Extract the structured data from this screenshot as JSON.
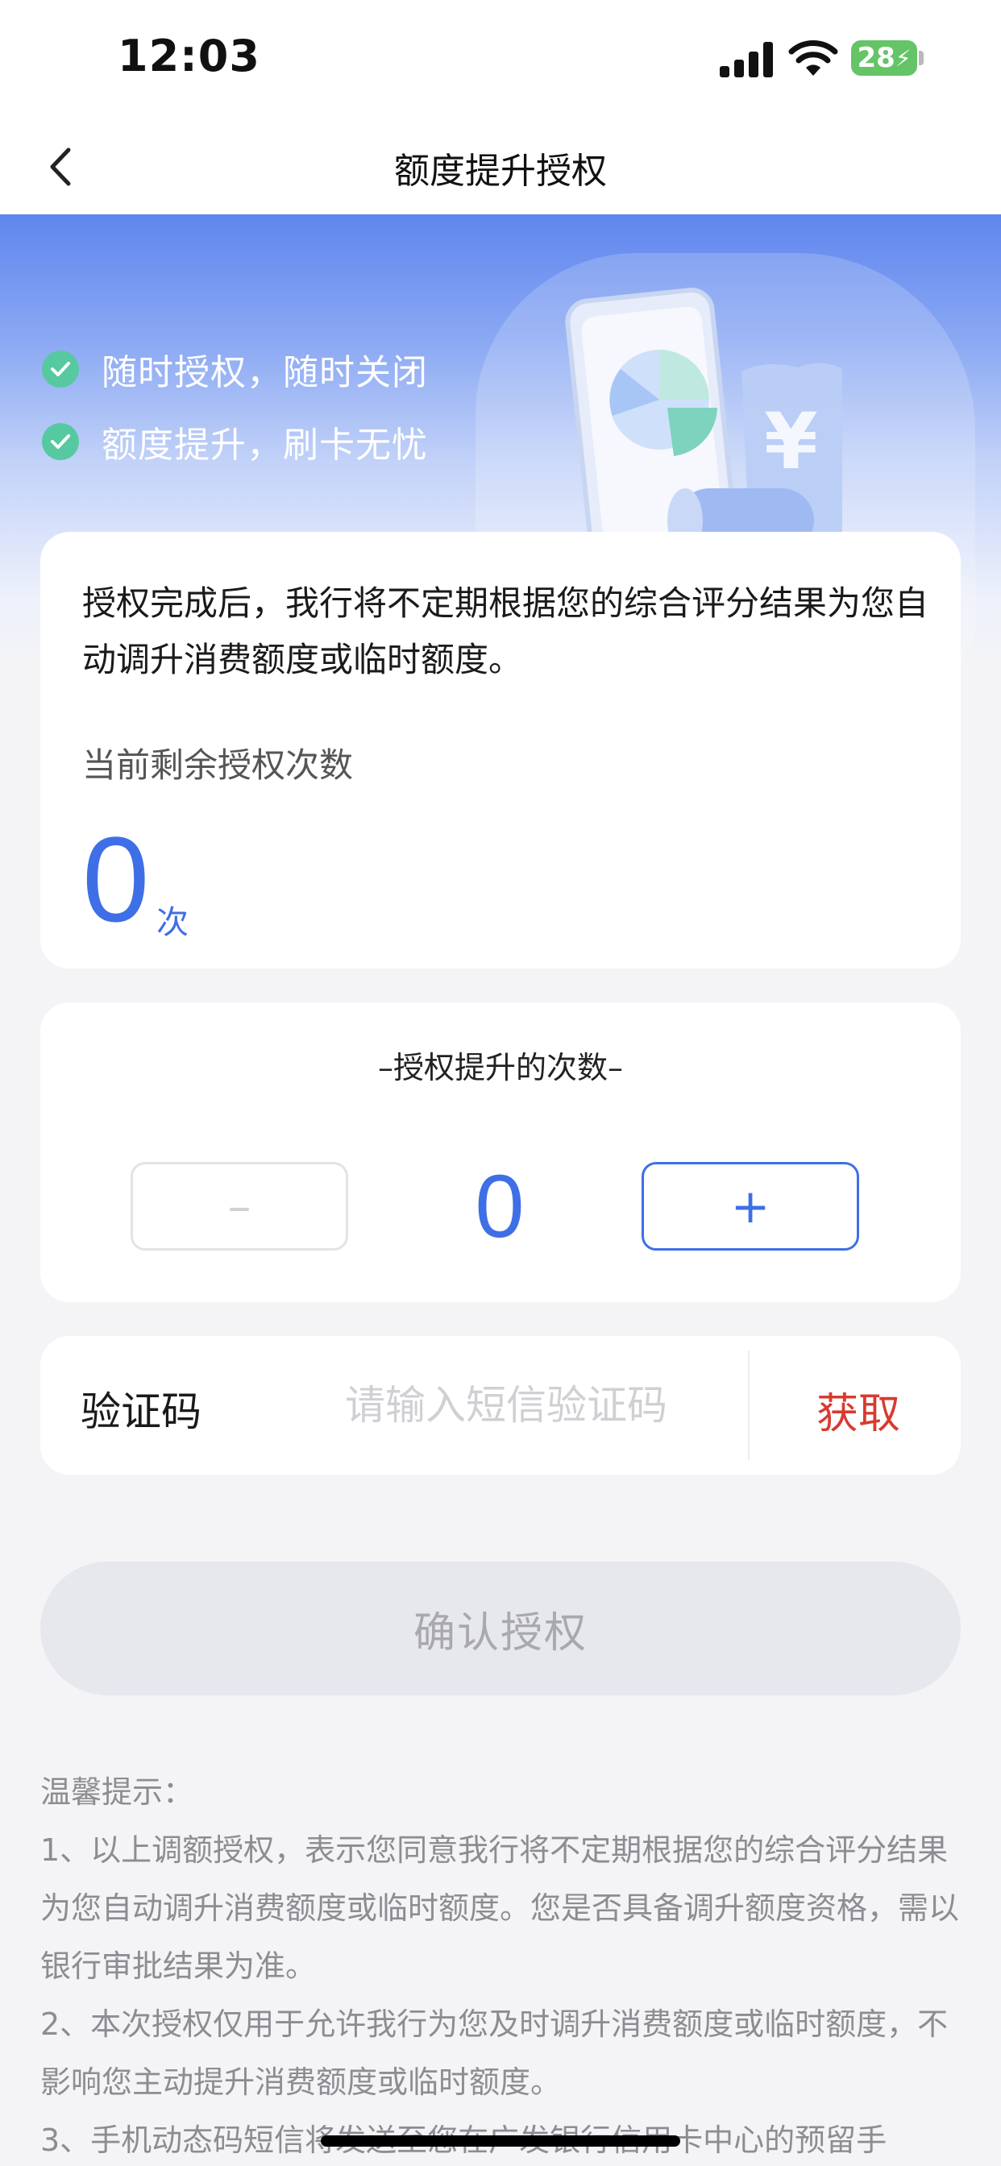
{
  "status_bar": {
    "time": "12:03",
    "battery": "28",
    "icons": [
      "signal-icon",
      "wifi-icon",
      "battery-charging-icon"
    ]
  },
  "nav": {
    "title": "额度提升授权",
    "back_icon": "chevron-left-icon"
  },
  "banner": {
    "features": [
      "随时授权，随时关闭",
      "额度提升，刷卡无忧"
    ]
  },
  "info_card": {
    "description": "授权完成后，我行将不定期根据您的综合评分结果为您自动调升消费额度或临时额度。",
    "remaining_label": "当前剩余授权次数",
    "remaining_count": "0",
    "remaining_unit": "次"
  },
  "count_card": {
    "title": "–授权提升的次数–",
    "minus_label": "–",
    "plus_label": "+",
    "value": "0"
  },
  "code_card": {
    "label": "验证码",
    "placeholder": "请输入短信验证码",
    "value": "",
    "get_label": "获取"
  },
  "confirm_label": "确认授权",
  "tips": {
    "title": "温馨提示：",
    "items": [
      "1、以上调额授权，表示您同意我行将不定期根据您的综合评分结果为您自动调升消费额度或临时额度。您是否具备调升额度资格，需以银行审批结果为准。",
      "2、本次授权仅用于允许我行为您及时调升消费额度或临时额度，不影响您主动提升消费额度或临时额度。",
      "3、手机动态码短信将发送至您在广发银行信用卡中心的预留手"
    ]
  },
  "colors": {
    "accent": "#3f6fe6",
    "get_code": "#d83a2f",
    "check": "#56c9a0",
    "banner_top": "#5f86ee"
  }
}
